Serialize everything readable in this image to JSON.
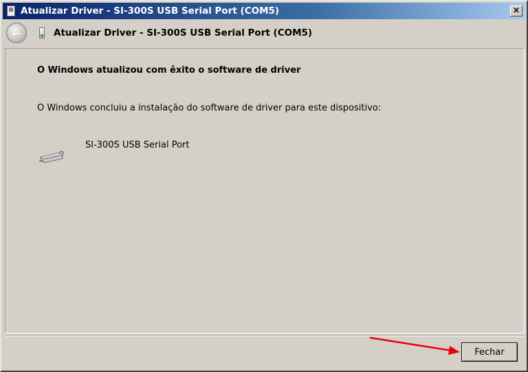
{
  "window": {
    "title": "Atualizar Driver -  SI-300S USB Serial Port (COM5)",
    "close_glyph": "×"
  },
  "nav": {
    "back_glyph": "←",
    "title": "Atualizar Driver -  SI-300S USB Serial Port (COM5)"
  },
  "content": {
    "heading": "O Windows atualizou com êxito o software de driver",
    "description": "O Windows concluiu a instalação do software de driver para este dispositivo:",
    "device_name": "SI-300S USB Serial Port",
    "device_icon": "serial-port-icon"
  },
  "footer": {
    "close_label": "Fechar"
  },
  "colors": {
    "titlebar_start": "#0a246a",
    "titlebar_end": "#a6caf0",
    "window_bg": "#d4d0c8",
    "annotation_arrow": "#e8000b"
  }
}
